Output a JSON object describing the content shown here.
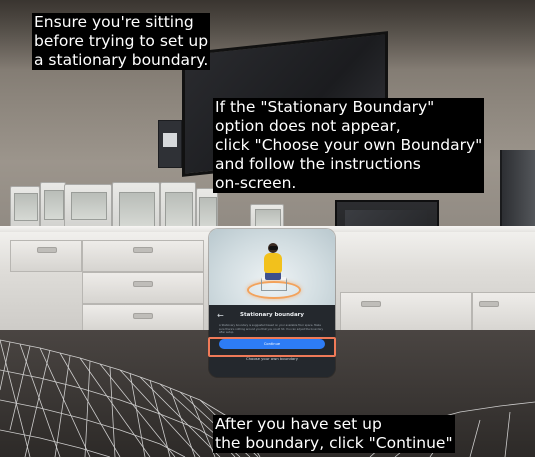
{
  "captions": {
    "top": [
      "Ensure you're sitting",
      "before trying to set up",
      "a stationary boundary."
    ],
    "right": [
      "If the \"Stationary Boundary\"",
      "option does not appear,",
      "click \"Choose your own Boundary\"",
      "and follow the instructions",
      "on-screen."
    ],
    "bottom": [
      "After you have set up",
      "the boundary, click \"Continue\""
    ]
  },
  "panel": {
    "back_icon": "arrow-left-icon",
    "title": "Stationary boundary",
    "description": "A Stationary boundary is suggested based on your available floor space. Make sure there's nothing around you that you could hit. You can adjust the boundary after setup.",
    "continue_label": "Continue",
    "own_boundary_label": "Choose your own boundary"
  },
  "colors": {
    "caption_bg": "#000000",
    "caption_text": "#ffffff",
    "continue_button": "#2d7cf6",
    "highlight_box": "#ef7a58",
    "panel_body": "#24282d",
    "ring": "#f3a25b"
  }
}
